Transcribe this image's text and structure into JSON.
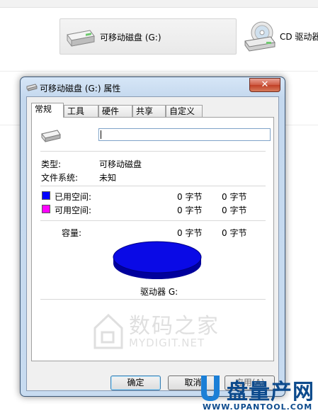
{
  "explorer": {
    "drive_tile_label": "可移动磁盘 (G:)",
    "cd_tile_label": "CD 驱动器"
  },
  "dialog": {
    "title": "可移动磁盘 (G:) 属性",
    "close_glyph": "✕",
    "tabs": [
      "常规",
      "工具",
      "硬件",
      "共享",
      "自定义"
    ],
    "active_tab": "常规",
    "name_input_value": "",
    "type_label": "类型:",
    "type_value": "可移动磁盘",
    "fs_label": "文件系统:",
    "fs_value": "未知",
    "used_label": "已用空间:",
    "used_bytes": "0 字节",
    "used_size": "0 字节",
    "free_label": "可用空间:",
    "free_bytes": "0 字节",
    "free_size": "0 字节",
    "capacity_label": "容量:",
    "capacity_bytes": "0 字节",
    "capacity_size": "0 字节",
    "drive_caption": "驱动器 G:",
    "ok_label": "确定",
    "cancel_label": "取消",
    "apply_label": "应用(A)"
  },
  "colors": {
    "used": "#0000ff",
    "free": "#ff00ff",
    "pie_top": "#0a0ae6",
    "pie_side": "#00009c"
  },
  "watermarks": {
    "mydigit_cn": "数码之家",
    "mydigit_en": "MYDIGIT.NET",
    "upantool_cn": "盘量产网",
    "upantool_en": "WWW.UPANTOOL.COM"
  }
}
